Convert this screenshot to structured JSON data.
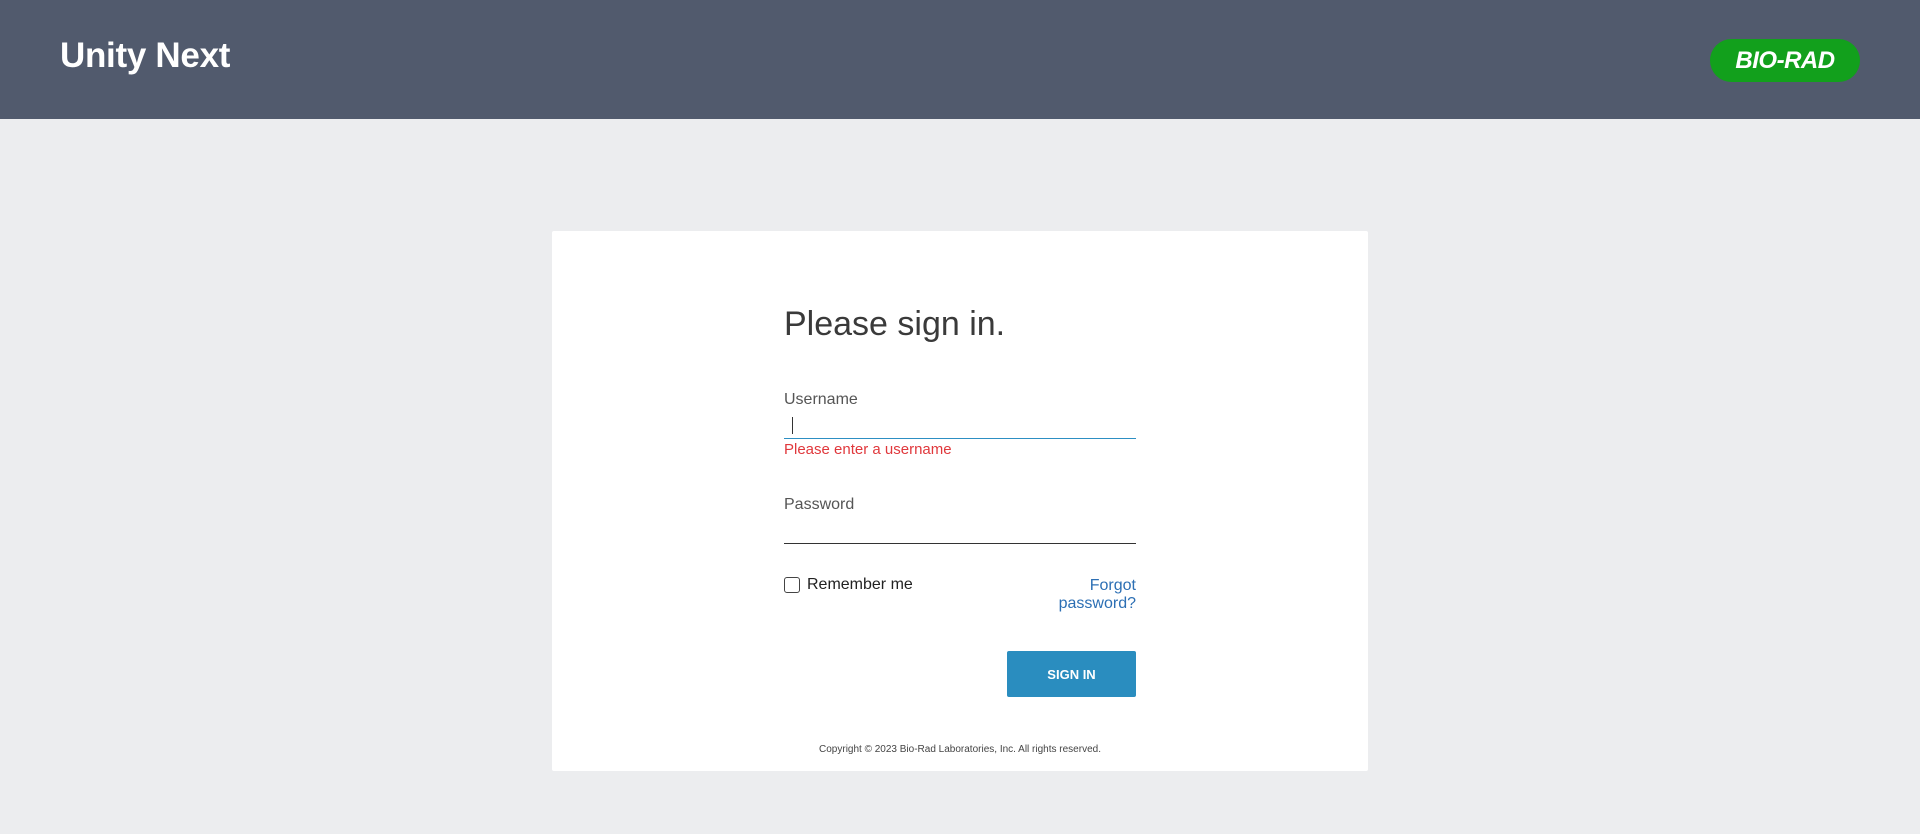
{
  "header": {
    "app_title": "Unity Next",
    "logo_text": "BIO-RAD",
    "background_color": "#515a6d",
    "logo_color": "#12a01c"
  },
  "login": {
    "heading": "Please sign in.",
    "username": {
      "label": "Username",
      "value": "",
      "error": "Please enter a username"
    },
    "password": {
      "label": "Password",
      "value": ""
    },
    "remember_me": {
      "label": "Remember me",
      "checked": false
    },
    "forgot_password": "Forgot password?",
    "sign_in_button": "SIGN IN",
    "copyright": "Copyright © 2023 Bio-Rad Laboratories, Inc. All rights reserved."
  },
  "colors": {
    "accent": "#2a8dbf",
    "error": "#e0383c",
    "link": "#2c6fb4",
    "page_background": "#ecedef"
  }
}
